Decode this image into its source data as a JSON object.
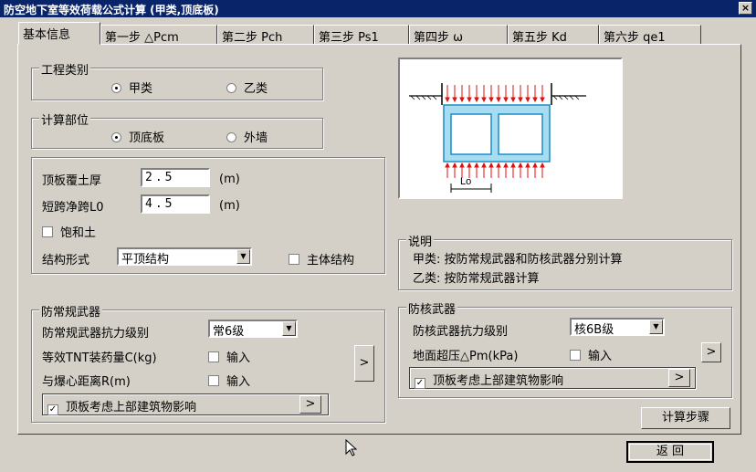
{
  "window": {
    "title": "防空地下室等效荷载公式计算 (甲类,顶底板)",
    "close_glyph": "×"
  },
  "tabs": [
    {
      "label": "基本信息"
    },
    {
      "label": "第一步 △Pcm"
    },
    {
      "label": "第二步 Pch"
    },
    {
      "label": "第三步 Ps1"
    },
    {
      "label": "第四步 ω"
    },
    {
      "label": "第五步 Kd"
    },
    {
      "label": "第六步 qe1"
    }
  ],
  "project_type": {
    "title": "工程类别",
    "option_a": "甲类",
    "option_b": "乙类",
    "selected": "甲类"
  },
  "calc_part": {
    "title": "计算部位",
    "option_a": "顶底板",
    "option_b": "外墙",
    "selected": "顶底板"
  },
  "params": {
    "soil_label": "顶板覆土厚",
    "soil_value": "2.5",
    "soil_unit": "(m)",
    "span_label": "短跨净跨L0",
    "span_value": "4.5",
    "span_unit": "(m)",
    "saturated_label": "饱和土",
    "saturated_checked": false,
    "struct_label": "结构形式",
    "struct_value": "平顶结构",
    "main_struct_label": "主体结构",
    "main_struct_checked": false
  },
  "explain": {
    "title": "说明",
    "line1": "甲类: 按防常规武器和防核武器分别计算",
    "line2": "乙类: 按防常规武器计算"
  },
  "conventional": {
    "title": "防常规武器",
    "level_label": "防常规武器抗力级别",
    "level_value": "常6级",
    "tnt_label": "等效TNT装药量C(kg)",
    "tnt_input_label": "输入",
    "tnt_checked": false,
    "dist_label": "与爆心距离R(m)",
    "dist_input_label": "输入",
    "dist_checked": false,
    "arrow": ">",
    "upper_label": "顶板考虑上部建筑物影响",
    "upper_checked": true,
    "upper_arrow": ">"
  },
  "nuclear": {
    "title": "防核武器",
    "level_label": "防核武器抗力级别",
    "level_value": "核6B级",
    "pressure_label": "地面超压△Pm(kPa)",
    "pressure_input_label": "输入",
    "pressure_checked": false,
    "arrow": ">",
    "upper_label": "顶板考虑上部建筑物影响",
    "upper_checked": true,
    "upper_arrow": ">"
  },
  "diagram": {
    "span_label": "Lo"
  },
  "buttons": {
    "calc_steps": "计算步骤",
    "back": "返 回"
  },
  "check_glyph": "✓",
  "colors": {
    "title_bar": "#0a246a",
    "dialog": "#d4d0c8",
    "load_arrows": "#e01010",
    "structure_fill": "#a8dcf0",
    "structure_line": "#1c8cc8"
  }
}
